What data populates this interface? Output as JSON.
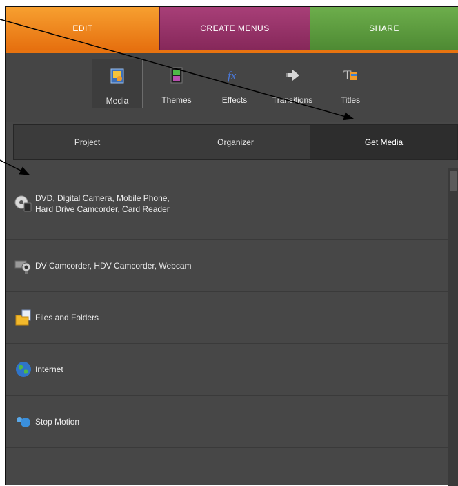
{
  "top_tabs": [
    {
      "label": "EDIT",
      "color": "#f0891f"
    },
    {
      "label": "CREATE MENUS",
      "color": "#9a3469"
    },
    {
      "label": "SHARE",
      "color": "#5c9c3f"
    }
  ],
  "tools": [
    {
      "label": "Media",
      "icon": "media-icon",
      "selected": true
    },
    {
      "label": "Themes",
      "icon": "themes-icon"
    },
    {
      "label": "Effects",
      "icon": "effects-icon"
    },
    {
      "label": "Transitions",
      "icon": "transitions-icon"
    },
    {
      "label": "Titles",
      "icon": "titles-icon"
    }
  ],
  "subtabs": [
    {
      "label": "Project"
    },
    {
      "label": "Organizer"
    },
    {
      "label": "Get Media",
      "selected": true
    }
  ],
  "media_items": [
    {
      "line1": "DVD, Digital Camera, Mobile Phone,",
      "line2": "Hard Drive Camcorder, Card Reader",
      "icon": "dvd-camera-icon"
    },
    {
      "line1": "DV Camcorder, HDV Camcorder, Webcam",
      "icon": "camcorder-icon"
    },
    {
      "line1": "Files and Folders",
      "icon": "folder-icon"
    },
    {
      "line1": "Internet",
      "icon": "globe-icon"
    },
    {
      "line1": "Stop Motion",
      "icon": "stop-motion-icon"
    }
  ],
  "colors": {
    "panel": "#474747",
    "accent_orange": "#e8730f",
    "annotation_arrow": "#000000"
  }
}
